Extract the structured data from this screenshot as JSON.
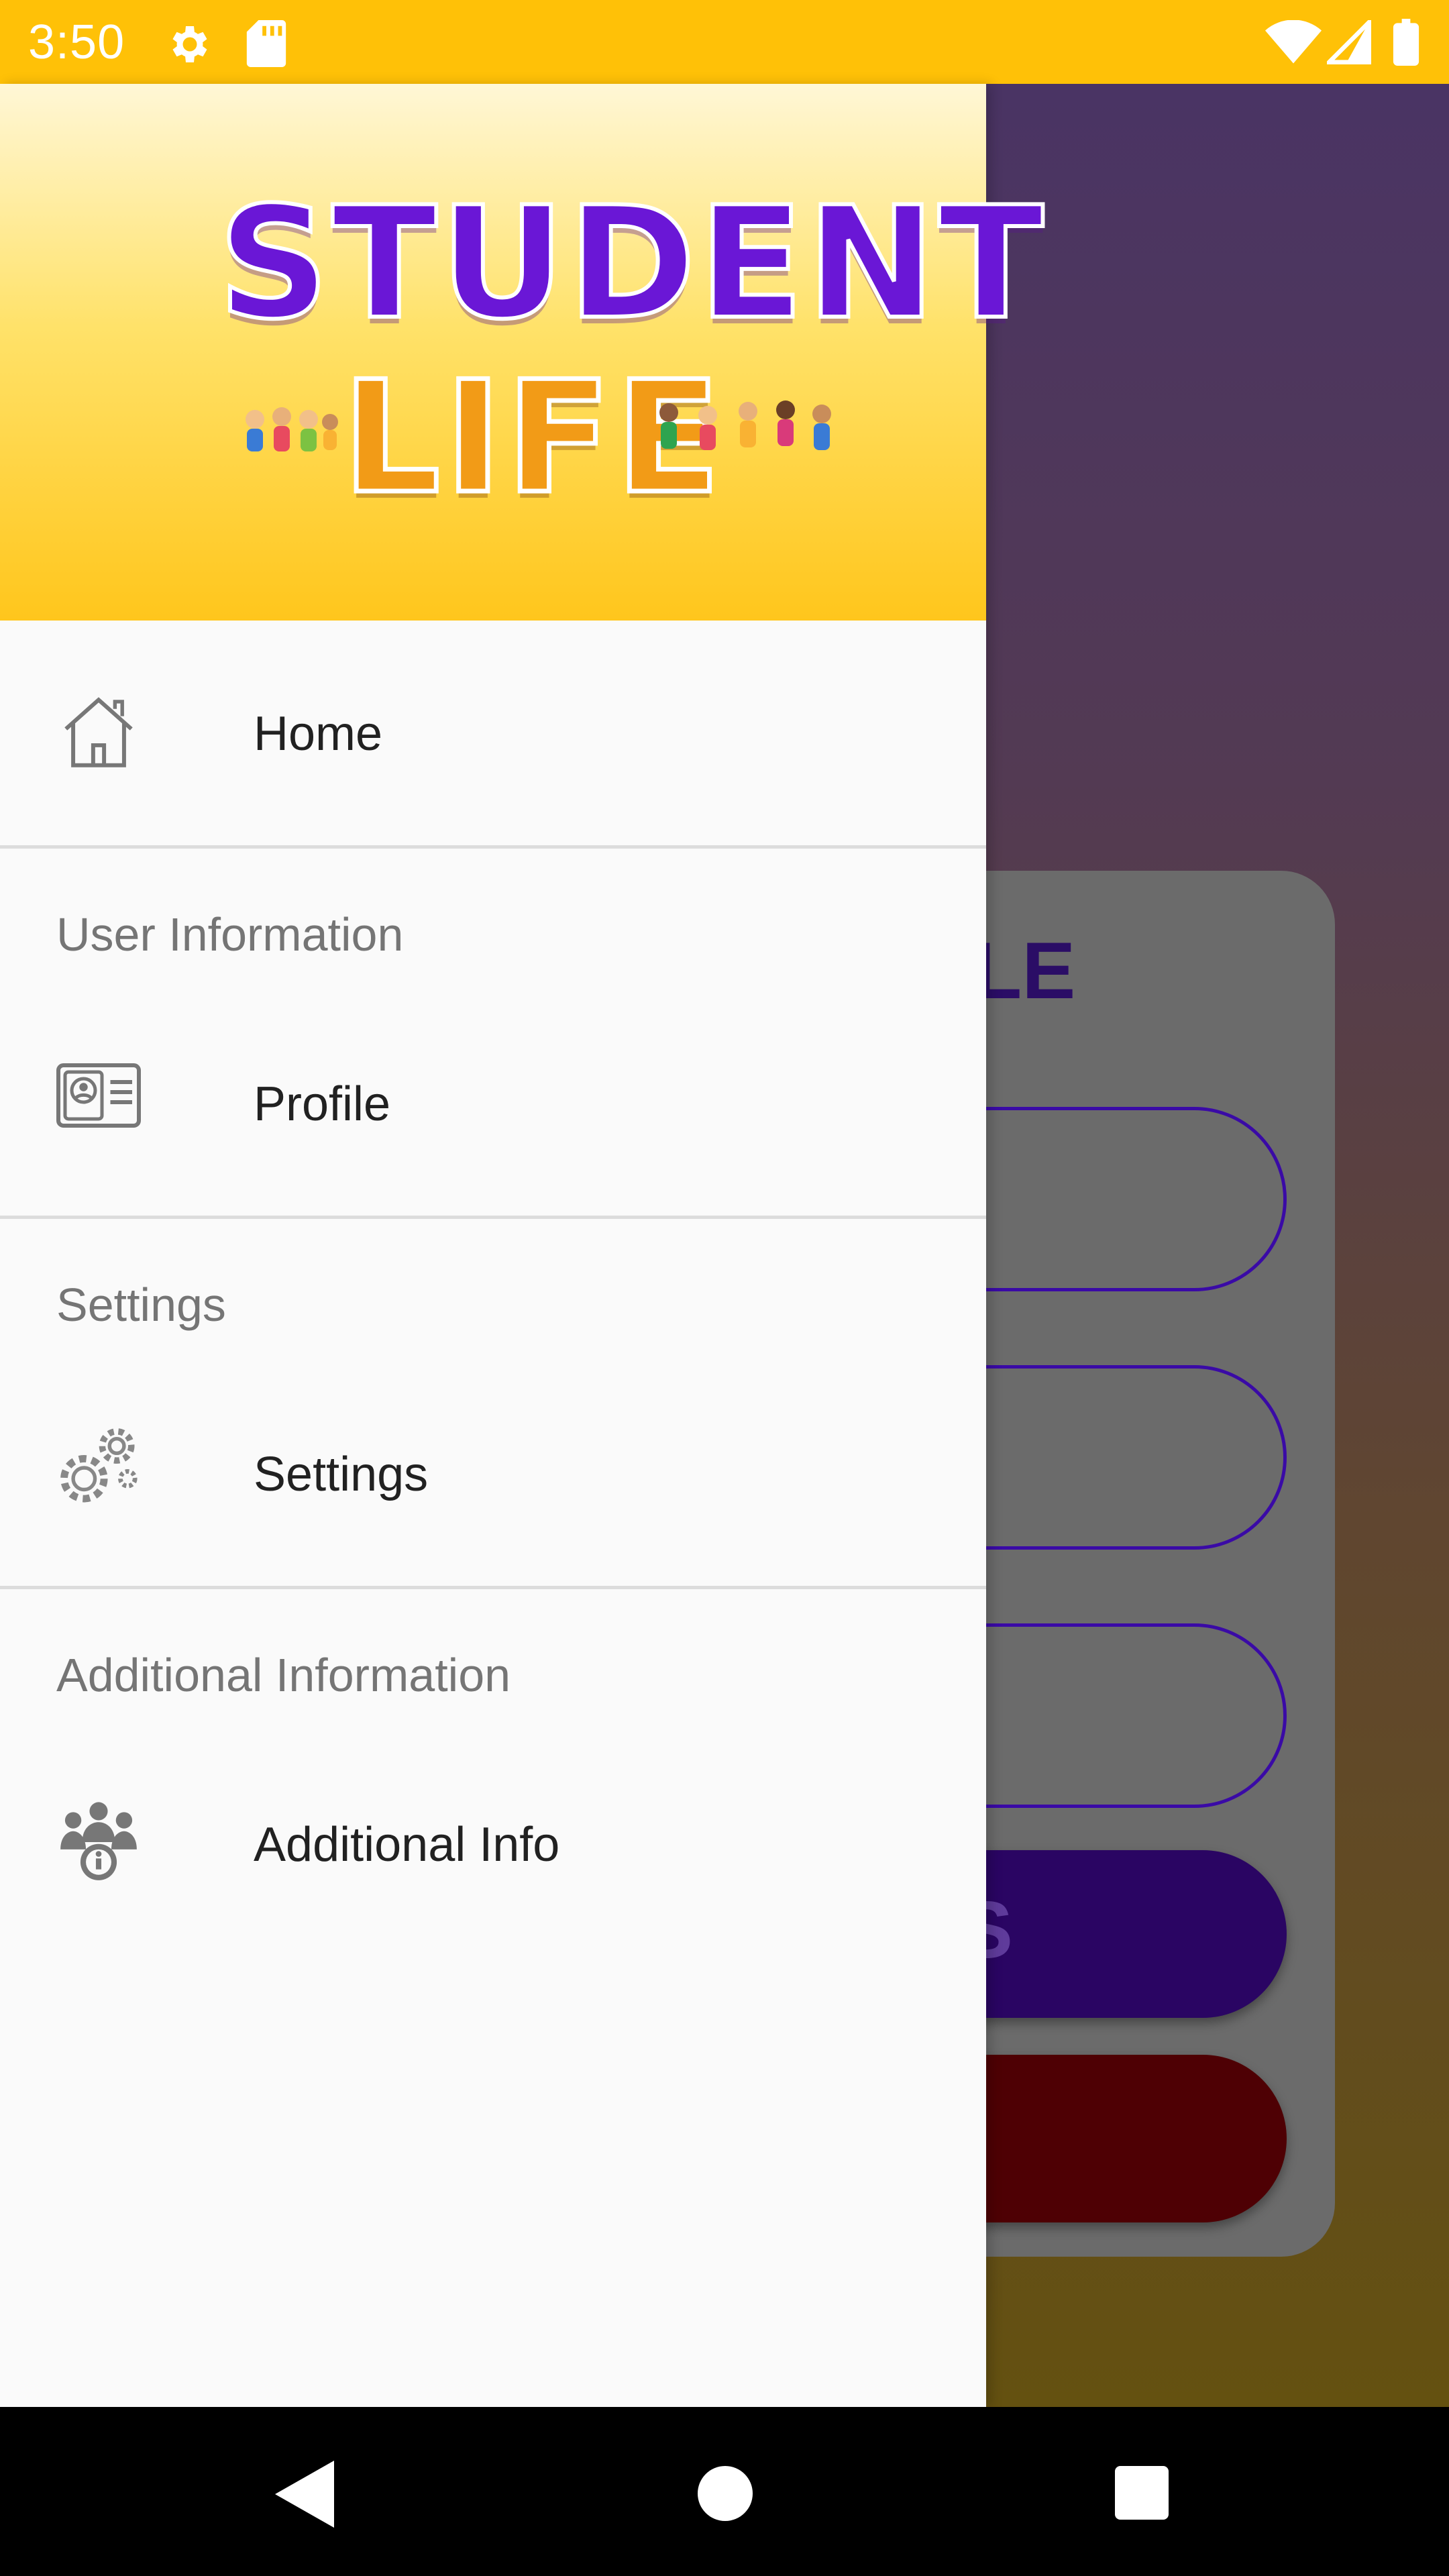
{
  "status_bar": {
    "time": "3:50",
    "background": "#FFC107"
  },
  "background_app": {
    "title_fragment": "LE",
    "button_fragment": "S"
  },
  "drawer": {
    "header": {
      "logo_line1": "STUDENT",
      "logo_line2": "LIFE"
    },
    "items": [
      {
        "label": "Home",
        "icon": "home-icon"
      },
      {
        "section": "User Information"
      },
      {
        "label": "Profile",
        "icon": "id-card-icon"
      },
      {
        "section": "Settings"
      },
      {
        "label": "Settings",
        "icon": "gears-icon"
      },
      {
        "section": "Additional Information"
      },
      {
        "label": "Additional Info",
        "icon": "group-info-icon"
      }
    ]
  },
  "navigation_bar": {
    "buttons": [
      "back-icon",
      "home-circle-icon",
      "recents-icon"
    ]
  }
}
